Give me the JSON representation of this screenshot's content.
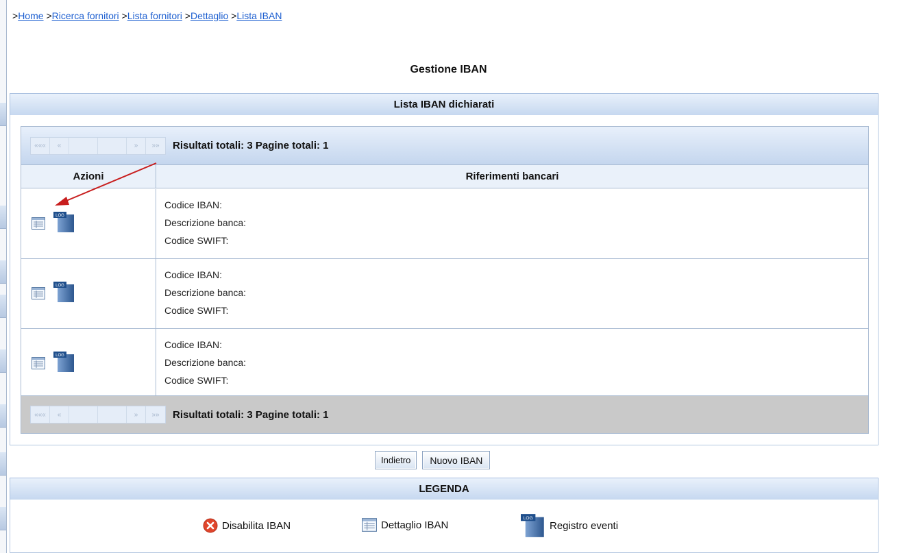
{
  "breadcrumb": {
    "separator": ">",
    "items": [
      "Home",
      "Ricerca fornitori",
      "Lista fornitori",
      "Dettaglio",
      "Lista IBAN"
    ]
  },
  "page_title": "Gestione IBAN",
  "list_section_title": "Lista IBAN dichiarati",
  "pager": {
    "first": "«««",
    "prev": "«",
    "next": "»",
    "last": "»»",
    "summary": "Risultati totali: 3 Pagine totali: 1"
  },
  "table": {
    "columns": [
      "Azioni",
      "Riferimenti bancari"
    ],
    "rows": [
      {
        "iban_label": "Codice IBAN:",
        "bank_label": "Descrizione banca:",
        "swift_label": "Codice SWIFT:"
      },
      {
        "iban_label": "Codice IBAN:",
        "bank_label": "Descrizione banca:",
        "swift_label": "Codice SWIFT:"
      },
      {
        "iban_label": "Codice IBAN:",
        "bank_label": "Descrizione banca:",
        "swift_label": "Codice SWIFT:"
      }
    ]
  },
  "buttons": {
    "back": "Indietro",
    "new_iban": "Nuovo IBAN"
  },
  "legend": {
    "title": "LEGENDA",
    "items": [
      {
        "icon": "disable-icon",
        "label": "Disabilita IBAN"
      },
      {
        "icon": "detail-icon",
        "label": "Dettaglio IBAN"
      },
      {
        "icon": "log-icon",
        "label": "Registro eventi"
      }
    ]
  },
  "log_icon_text": "LOG",
  "colors": {
    "link": "#1d5fd0",
    "header_gradient_top": "#e9f1fb",
    "header_gradient_bottom": "#c6d8f0",
    "annotation_arrow": "#c81e1e",
    "disable_icon": "#e0452b"
  }
}
